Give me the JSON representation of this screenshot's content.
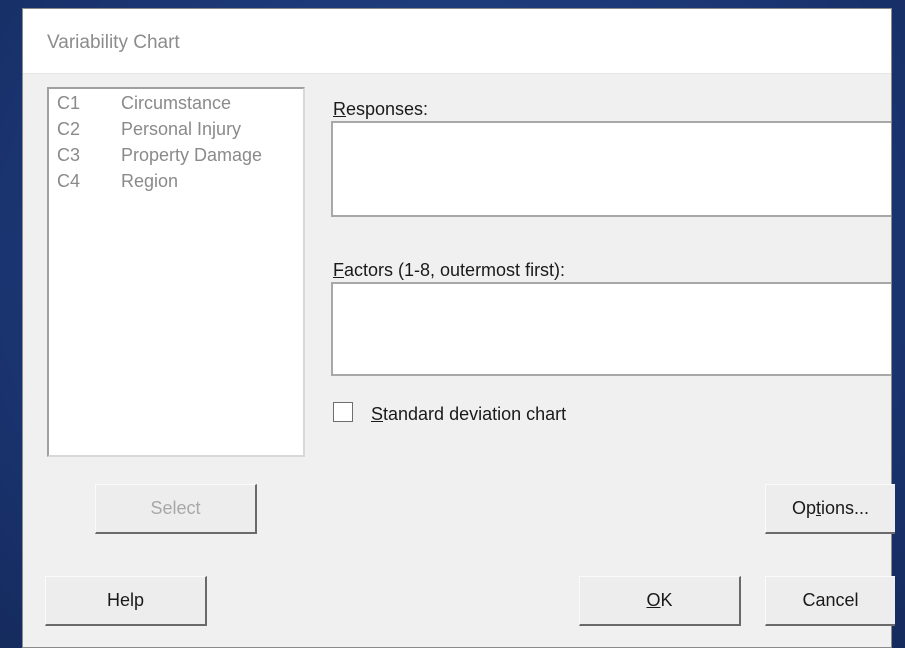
{
  "dialog": {
    "title": "Variability Chart",
    "variables": [
      {
        "id": "C1",
        "name": "Circumstance"
      },
      {
        "id": "C2",
        "name": "Personal Injury"
      },
      {
        "id": "C3",
        "name": "Property Damage"
      },
      {
        "id": "C4",
        "name": "Region"
      }
    ],
    "responses": {
      "accel": "R",
      "rest": "esponses:",
      "value": ""
    },
    "factors": {
      "accel": "F",
      "rest": "actors (1-8, outermost first):",
      "value": ""
    },
    "std_dev": {
      "accel": "S",
      "rest": "tandard deviation chart",
      "checked": false
    },
    "buttons": {
      "select": "Select",
      "options_pre": "Op",
      "options_accel": "t",
      "options_post": "ions...",
      "help": "Help",
      "ok_accel": "O",
      "ok_rest": "K",
      "cancel": "Cancel"
    }
  }
}
